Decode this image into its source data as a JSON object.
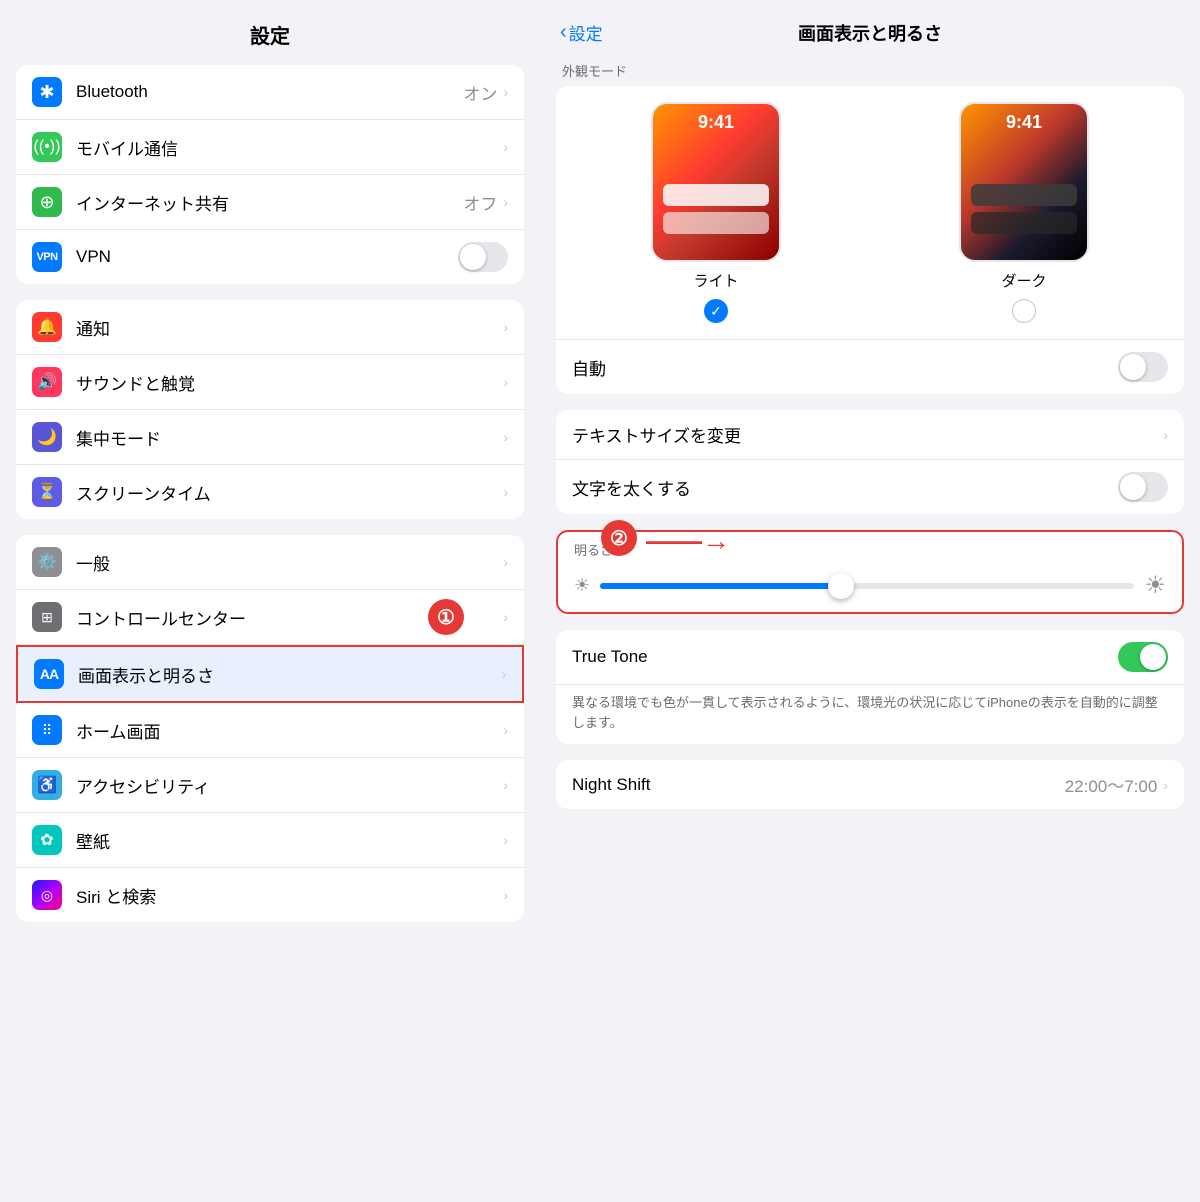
{
  "left": {
    "title": "設定",
    "groups": [
      {
        "items": [
          {
            "id": "bluetooth",
            "label": "Bluetooth",
            "value": "オン",
            "icon_color": "blue",
            "icon_type": "bluetooth",
            "has_chevron": true
          },
          {
            "id": "mobile",
            "label": "モバイル通信",
            "value": "",
            "icon_color": "green",
            "icon_type": "signal",
            "has_chevron": true
          },
          {
            "id": "hotspot",
            "label": "インターネット共有",
            "value": "オフ",
            "icon_color": "green2",
            "icon_type": "link",
            "has_chevron": true
          },
          {
            "id": "vpn",
            "label": "VPN",
            "value": "",
            "icon_color": "blue2",
            "icon_type": "vpn",
            "has_toggle": true,
            "toggle_on": false
          }
        ]
      },
      {
        "items": [
          {
            "id": "notifications",
            "label": "通知",
            "value": "",
            "icon_color": "red",
            "icon_type": "bell",
            "has_chevron": true
          },
          {
            "id": "sound",
            "label": "サウンドと触覚",
            "value": "",
            "icon_color": "pink",
            "icon_type": "speaker",
            "has_chevron": true
          },
          {
            "id": "focus",
            "label": "集中モード",
            "value": "",
            "icon_color": "purple",
            "icon_type": "moon",
            "has_chevron": true
          },
          {
            "id": "screentime",
            "label": "スクリーンタイム",
            "value": "",
            "icon_color": "indigo",
            "icon_type": "hourglass",
            "has_chevron": true
          }
        ]
      },
      {
        "items": [
          {
            "id": "general",
            "label": "一般",
            "value": "",
            "icon_color": "gray",
            "icon_type": "gear",
            "has_chevron": true
          },
          {
            "id": "control",
            "label": "コントロールセンター",
            "value": "",
            "icon_color": "gray2",
            "icon_type": "sliders",
            "has_chevron": true,
            "has_badge": true
          },
          {
            "id": "display",
            "label": "画面表示と明るさ",
            "value": "",
            "icon_color": "blue",
            "icon_type": "aa",
            "has_chevron": true,
            "highlighted": true
          },
          {
            "id": "home",
            "label": "ホーム画面",
            "value": "",
            "icon_color": "multi",
            "icon_type": "grid",
            "has_chevron": true
          },
          {
            "id": "accessibility",
            "label": "アクセシビリティ",
            "value": "",
            "icon_color": "teal",
            "icon_type": "person",
            "has_chevron": true
          },
          {
            "id": "wallpaper",
            "label": "壁紙",
            "value": "",
            "icon_color": "cyan",
            "icon_type": "flower",
            "has_chevron": true
          },
          {
            "id": "siri",
            "label": "Siri と検索",
            "value": "",
            "icon_color": "gradient",
            "icon_type": "siri",
            "has_chevron": true
          }
        ]
      }
    ]
  },
  "right": {
    "back_label": "設定",
    "title": "画面表示と明るさ",
    "appearance_label": "外観モード",
    "light_mode_label": "ライト",
    "dark_mode_label": "ダーク",
    "auto_label": "自動",
    "text_size_label": "テキストサイズを変更",
    "bold_text_label": "文字を太くする",
    "brightness_label": "明るさ",
    "true_tone_label": "True Tone",
    "true_tone_desc": "異なる環境でも色が一貫して表示されるように、環境光の状況に応じてiPhoneの表示を自動的に調整します。",
    "night_shift_label": "Night Shift",
    "night_shift_value": "22:00～7:00",
    "annotation_1": "①",
    "annotation_2": "②"
  }
}
